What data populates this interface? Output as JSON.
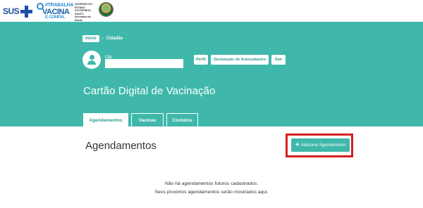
{
  "logos": {
    "sus": "SUS",
    "campaign": [
      "#TRABALHA",
      "VACINA",
      "E CONFIA."
    ],
    "government": [
      "GOVERNO DO ESTADO",
      "DO ESPÍRITO SANTO",
      "Secretaria da Saúde"
    ]
  },
  "breadcrumb": {
    "home": "Início",
    "separator": "›",
    "current": "Cidadão"
  },
  "user": {
    "greeting": "Olá"
  },
  "header_buttons": {
    "profile": "Perfil",
    "declaration": "Declaração de Autocadastro",
    "logout": "Sair"
  },
  "page_title": "Cartão Digital de Vacinação",
  "tabs": [
    {
      "label": "Agendamentos",
      "active": true
    },
    {
      "label": "Vacinas",
      "active": false
    },
    {
      "label": "Contatos",
      "active": false
    }
  ],
  "section": {
    "title": "Agendamentos",
    "add_button": "Adicionar Agendamento",
    "add_button_icon": "+"
  },
  "empty_state": {
    "line1": "Não há agendamentos futuros cadastrados.",
    "line2": "Seus proximos agendamentos serão mostrados aqui."
  },
  "colors": {
    "teal": "#3fb8ab",
    "highlight": "#d62020",
    "sus_blue": "#1f4fa3"
  }
}
